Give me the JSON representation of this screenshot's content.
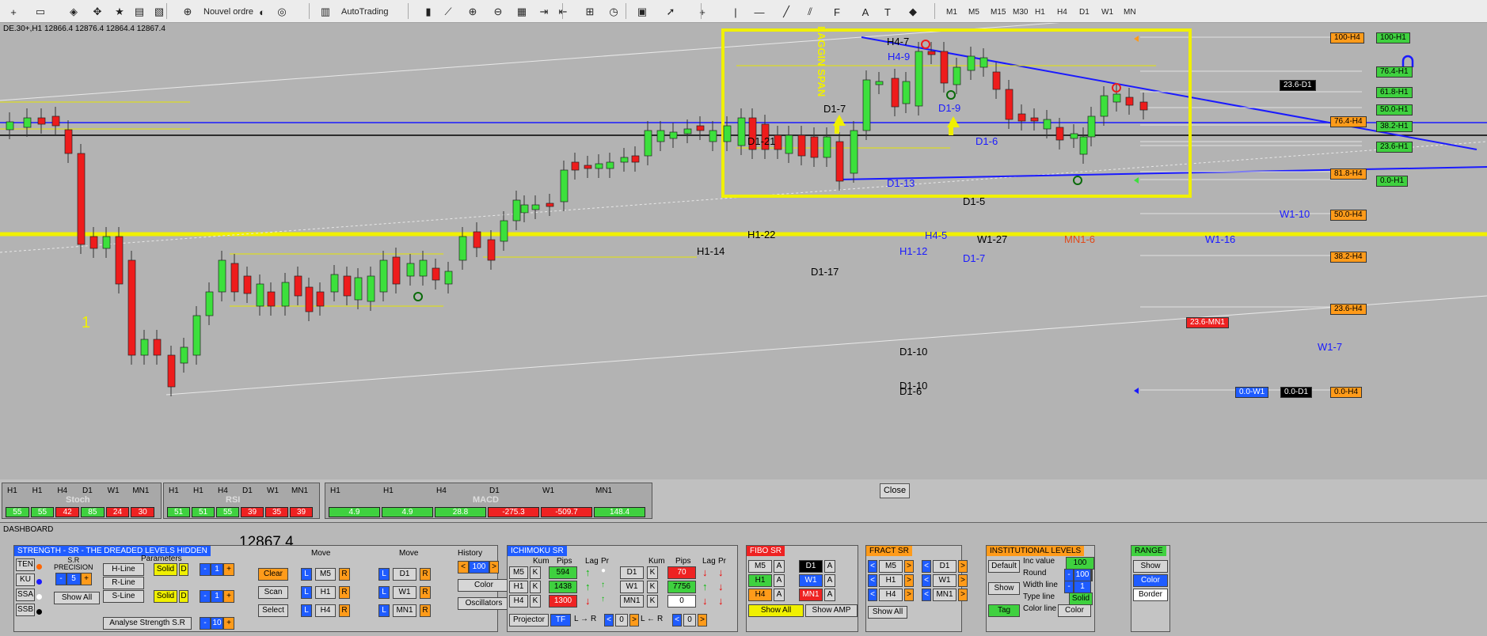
{
  "toolbar": {
    "new_order": "Nouvel ordre",
    "autotrading": "AutoTrading",
    "timeframes": [
      "M1",
      "M5",
      "M15",
      "M30",
      "H1",
      "H4",
      "D1",
      "W1",
      "MN"
    ],
    "icons": [
      "new-chart-icon",
      "profiles-icon",
      "crosshair-icon",
      "market-watch-icon",
      "navigator-icon",
      "terminal-icon",
      "tester-icon",
      "new-order-icon",
      "data-icon",
      "signal-icon",
      "bar-chart-icon",
      "candle-chart-icon",
      "line-chart-icon",
      "zoom-in-icon",
      "zoom-out-icon",
      "tile-icon",
      "autoscroll-icon",
      "chart-shift-icon",
      "indicators-icon",
      "period-icon",
      "templates-icon",
      "cursor-icon",
      "cross-icon",
      "vline-icon",
      "hline-icon",
      "trendline-icon",
      "channel-icon",
      "fibo-icon",
      "text-icon",
      "label-icon",
      "arrows-icon"
    ]
  },
  "chart": {
    "title": "DE.30+,H1  12866.4 12876.4 12864.4 12867.4",
    "labels": [
      {
        "t": "H4-7",
        "c": "#000"
      },
      {
        "t": "H4-9",
        "c": "#1a1aff"
      },
      {
        "t": "D1-7",
        "c": "#000"
      },
      {
        "t": "D1-9",
        "c": "#1a1aff"
      },
      {
        "t": "D1-21",
        "c": "#000"
      },
      {
        "t": "D1-6",
        "c": "#1a1aff"
      },
      {
        "t": "D1-13",
        "c": "#1a1aff"
      },
      {
        "t": "D1-5",
        "c": "#000"
      },
      {
        "t": "W1-10",
        "c": "#1a1aff"
      },
      {
        "t": "H1-22",
        "c": "#000"
      },
      {
        "t": "H4-5",
        "c": "#1a1aff"
      },
      {
        "t": "W1-27",
        "c": "#000"
      },
      {
        "t": "MN1-6",
        "c": "#e04a1a"
      },
      {
        "t": "W1-16",
        "c": "#1a1aff"
      },
      {
        "t": "H1-14",
        "c": "#000"
      },
      {
        "t": "H1-12",
        "c": "#1a1aff"
      },
      {
        "t": "D1-7",
        "c": "#1a1aff"
      },
      {
        "t": "D1-17",
        "c": "#000"
      },
      {
        "t": "1",
        "c": "#f0f000"
      },
      {
        "t": "D1-10",
        "c": "#000"
      },
      {
        "t": "W1-7",
        "c": "#1a1aff"
      },
      {
        "t": "D1-10",
        "c": "#000"
      },
      {
        "t": "D1-6",
        "c": "#000"
      },
      {
        "t": "LAGGIN SPAN",
        "c": "#f0f000"
      }
    ],
    "tags": [
      {
        "t": "100-H4",
        "k": "orange"
      },
      {
        "t": "100-H1",
        "k": "green"
      },
      {
        "t": "76.4-H1",
        "k": "green"
      },
      {
        "t": "23.6-D1",
        "k": "black"
      },
      {
        "t": "61.8-H1",
        "k": "green"
      },
      {
        "t": "50.0-H1",
        "k": "green"
      },
      {
        "t": "76.4-H4",
        "k": "orange"
      },
      {
        "t": "38.2-H1",
        "k": "green"
      },
      {
        "t": "23.6-H1",
        "k": "green"
      },
      {
        "t": "81.8-H4",
        "k": "orange"
      },
      {
        "t": "0.0-H1",
        "k": "green"
      },
      {
        "t": "50.0-H4",
        "k": "orange"
      },
      {
        "t": "38.2-H4",
        "k": "orange"
      },
      {
        "t": "23.6-H4",
        "k": "orange"
      },
      {
        "t": "23.6-MN1",
        "k": "red"
      },
      {
        "t": "0.0-W1",
        "k": "blue"
      },
      {
        "t": "0.0-D1",
        "k": "black"
      },
      {
        "t": "0.0-H4",
        "k": "orange"
      }
    ]
  },
  "indicators": {
    "stoch": {
      "name": "Stoch",
      "heads": [
        "H1",
        "H1",
        "H4",
        "D1",
        "W1",
        "MN1"
      ],
      "vals": [
        {
          "v": "55",
          "k": "green"
        },
        {
          "v": "55",
          "k": "green"
        },
        {
          "v": "42",
          "k": "red"
        },
        {
          "v": "85",
          "k": "green"
        },
        {
          "v": "24",
          "k": "red"
        },
        {
          "v": "30",
          "k": "red"
        }
      ]
    },
    "rsi": {
      "name": "RSI",
      "heads": [
        "H1",
        "H1",
        "H4",
        "D1",
        "W1",
        "MN1"
      ],
      "vals": [
        {
          "v": "51",
          "k": "green"
        },
        {
          "v": "51",
          "k": "green"
        },
        {
          "v": "55",
          "k": "green"
        },
        {
          "v": "39",
          "k": "red"
        },
        {
          "v": "35",
          "k": "red"
        },
        {
          "v": "39",
          "k": "red"
        }
      ]
    },
    "macd": {
      "name": "MACD",
      "heads": [
        "H1",
        "H1",
        "H4",
        "D1",
        "W1",
        "MN1"
      ],
      "vals": [
        {
          "v": "4.9",
          "k": "green"
        },
        {
          "v": "4.9",
          "k": "green"
        },
        {
          "v": "28.8",
          "k": "green"
        },
        {
          "v": "-275.3",
          "k": "red"
        },
        {
          "v": "-509.7",
          "k": "red"
        },
        {
          "v": "148.4",
          "k": "green"
        }
      ]
    },
    "close": "Close"
  },
  "dashboard": {
    "label": "DASHBOARD",
    "price": "12867.4",
    "strength": {
      "title": "STRENGTH - SR - THE DREADED LEVELS HIDDEN",
      "side": [
        "TEN",
        "KU",
        "SSA",
        "SSB"
      ],
      "sr_precision": "S.R\nPRECISION",
      "precision_val": "5",
      "show_all": "Show All",
      "params": "Parameters",
      "lines": [
        "H-Line",
        "R-Line",
        "S-Line"
      ],
      "styles": [
        "Solid",
        "Solid"
      ],
      "d": "D",
      "widths": [
        "1",
        "1",
        "10"
      ],
      "analyse": "Analyse Strength S.R",
      "clear": "Clear",
      "scan": "Scan",
      "select": "Select",
      "move": "Move",
      "tf1": [
        "M5",
        "H1",
        "H4"
      ],
      "tf2": [
        "D1",
        "W1",
        "MN1"
      ],
      "l": "L",
      "r": "R",
      "history": "History",
      "history_val": "100",
      "color": "Color",
      "osc": "Oscillators"
    },
    "ichimoku": {
      "title": "ICHIMOKU SR",
      "heads": [
        "Kum",
        "Pips",
        "Lag",
        "Pr"
      ],
      "rows": [
        {
          "tf": "M5",
          "pips": "594",
          "k": "green"
        },
        {
          "tf": "H1",
          "pips": "1438",
          "k": "green"
        },
        {
          "tf": "H4",
          "pips": "1300",
          "k": "red"
        }
      ],
      "rows2": [
        {
          "tf": "D1",
          "pips": "70",
          "k": "red"
        },
        {
          "tf": "W1",
          "pips": "7756",
          "k": "green"
        },
        {
          "tf": "MN1",
          "pips": "0",
          "k": "white"
        }
      ],
      "k": "K",
      "projector": "Projector",
      "tf": "TF",
      "l": "L",
      "r": "R",
      "zero": "0"
    },
    "fibo": {
      "title": "FIBO SR",
      "a": "A",
      "tfs": [
        {
          "t": "M5",
          "k": "n"
        },
        {
          "t": "D1",
          "k": "black"
        },
        {
          "t": "H1",
          "k": "green"
        },
        {
          "t": "W1",
          "k": "blue"
        },
        {
          "t": "H4",
          "k": "orange"
        },
        {
          "t": "MN1",
          "k": "red"
        }
      ],
      "show_all": "Show All",
      "show_amp": "Show AMP"
    },
    "fract": {
      "title": "FRACT SR",
      "tfs": [
        "M5",
        "D1",
        "H1",
        "W1",
        "H4",
        "MN1"
      ],
      "show_all": "Show All"
    },
    "inst": {
      "title": "INSTITUTIONAL LEVELS",
      "default": "Default",
      "show": "Show",
      "tag": "Tag",
      "inc": "Inc value",
      "inc_val": "100",
      "round": "Round",
      "round_val": "100",
      "width": "Width line",
      "width_val": "1",
      "type": "Type line",
      "type_val": "Solid",
      "colorline": "Color line",
      "color": "Color"
    },
    "range": {
      "title": "RANGE",
      "show": "Show",
      "color": "Color",
      "border": "Border"
    }
  }
}
